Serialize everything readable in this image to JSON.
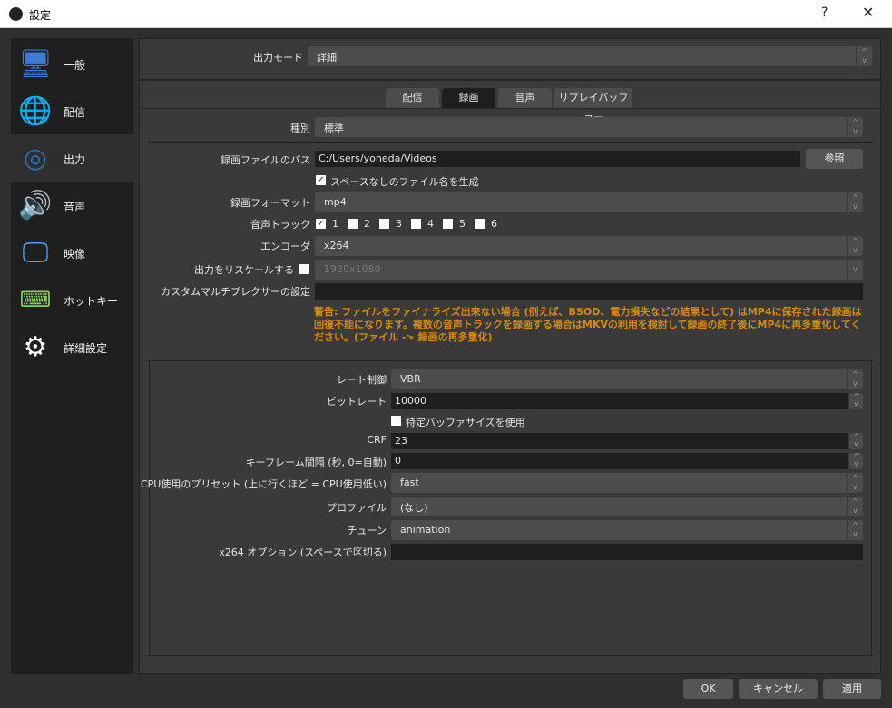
{
  "window": {
    "title": "設定",
    "help": "?",
    "close": "✕"
  },
  "sidebar": {
    "items": [
      {
        "label": "一般",
        "icon": "general-icon"
      },
      {
        "label": "配信",
        "icon": "globe-icon"
      },
      {
        "label": "出力",
        "icon": "output-icon"
      },
      {
        "label": "音声",
        "icon": "speaker-icon"
      },
      {
        "label": "映像",
        "icon": "monitor-icon"
      },
      {
        "label": "ホットキー",
        "icon": "keyboard-icon"
      },
      {
        "label": "詳細設定",
        "icon": "gears-icon"
      }
    ],
    "selected": "出力"
  },
  "output_mode": {
    "label": "出力モード",
    "value": "詳細"
  },
  "tabs": [
    {
      "label": "配信"
    },
    {
      "label": "録画"
    },
    {
      "label": "音声"
    },
    {
      "label": "リプレイバッファー"
    }
  ],
  "recording": {
    "type_label": "種別",
    "type_value": "標準",
    "path_label": "録画ファイルのパス",
    "path_value": "C:/Users/yoneda/Videos",
    "browse": "参照",
    "nospace_label": "スペースなしのファイル名を生成",
    "nospace_checked": true,
    "format_label": "録画フォーマット",
    "format_value": "mp4",
    "tracks_label": "音声トラック",
    "tracks": [
      {
        "n": "1",
        "checked": true
      },
      {
        "n": "2",
        "checked": false
      },
      {
        "n": "3",
        "checked": false
      },
      {
        "n": "4",
        "checked": false
      },
      {
        "n": "5",
        "checked": false
      },
      {
        "n": "6",
        "checked": false
      }
    ],
    "encoder_label": "エンコーダ",
    "encoder_value": "x264",
    "rescale_label": "出力をリスケールする",
    "rescale_checked": false,
    "rescale_value": "1920x1080",
    "muxer_label": "カスタムマルチプレクサーの設定",
    "muxer_value": "",
    "warning": "警告: ファイルをファイナライズ出来ない場合 (例えば、BSOD、電力損失などの結果として) はMP4に保存された録画は回復不能になります。複数の音声トラックを録画する場合はMKVの利用を検討して録画の終了後にMP4に再多重化してください。(ファイル -> 録画の再多重化)"
  },
  "encoder": {
    "rate_label": "レート制御",
    "rate_value": "VBR",
    "bitrate_label": "ビットレート",
    "bitrate_value": "10000",
    "buffer_label": "特定バッファサイズを使用",
    "buffer_checked": false,
    "crf_label": "CRF",
    "crf_value": "23",
    "keyframe_label": "キーフレーム間隔 (秒, 0=自動)",
    "keyframe_value": "0",
    "preset_label": "CPU使用のプリセット (上に行くほど = CPU使用低い)",
    "preset_value": "fast",
    "profile_label": "プロファイル",
    "profile_value": "(なし)",
    "tune_label": "チューン",
    "tune_value": "animation",
    "options_label": "x264 オプション (スペースで区切る)",
    "options_value": ""
  },
  "footer": {
    "ok": "OK",
    "cancel": "キャンセル",
    "apply": "適用"
  }
}
